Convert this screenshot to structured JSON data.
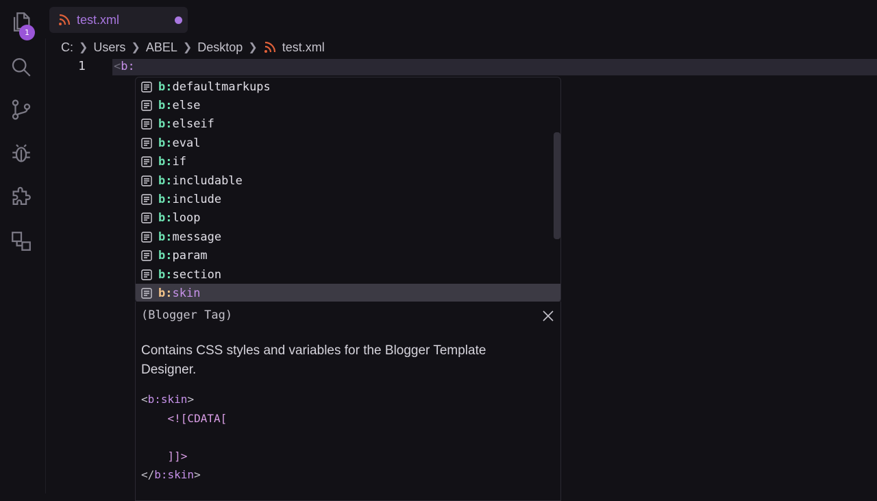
{
  "activity_bar": {
    "explorer_badge": "1",
    "icons": [
      "files-icon",
      "search-icon",
      "source-control-icon",
      "debug-icon",
      "extensions-icon",
      "remote-explorer-icon"
    ]
  },
  "tab": {
    "label": "test.xml"
  },
  "breadcrumb": {
    "parts": [
      "C:",
      "Users",
      "ABEL",
      "Desktop"
    ],
    "file": "test.xml"
  },
  "editor": {
    "line_number": "1",
    "code_lt": "<",
    "code_text": "b:"
  },
  "suggestions": {
    "prefix": "b:",
    "items": [
      "defaultmarkups",
      "else",
      "elseif",
      "eval",
      "if",
      "includable",
      "include",
      "loop",
      "message",
      "param",
      "section",
      "skin"
    ],
    "selected": "skin"
  },
  "details": {
    "kind": "(Blogger Tag)",
    "description": "Contains CSS styles and variables for the Blogger Template Designer.",
    "code": {
      "l1_lt": "<",
      "l1_tag": "b:skin",
      "l1_gt": ">",
      "l2": "<![CDATA[",
      "l3": "",
      "l4": "]]>",
      "l5_lt": "</",
      "l5_tag": "b:skin",
      "l5_gt": ">"
    }
  },
  "colors": {
    "accent": "#a977e0",
    "suggest_prefix": "#6fe3b3",
    "selected_prefix": "#f4c48a",
    "background": "#121116"
  }
}
